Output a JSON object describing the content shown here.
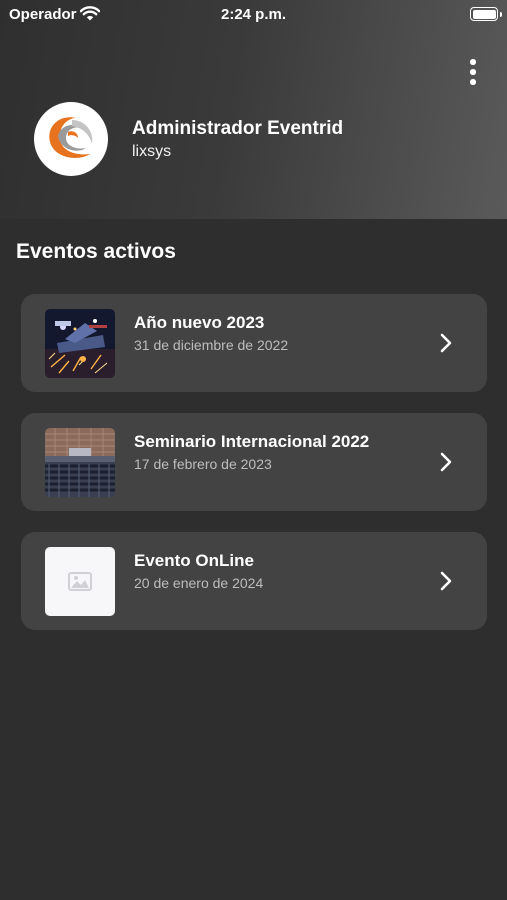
{
  "status_bar": {
    "carrier": "Operador",
    "time": "2:24 p.m.",
    "wifi_icon": "wifi-icon",
    "battery_icon": "battery-icon",
    "battery_level": 1.0
  },
  "header": {
    "menu_icon": "more-vertical-icon",
    "profile_name": "Administrador Eventrid",
    "profile_org": "lixsys",
    "avatar_icon": "eventrid-logo"
  },
  "section_title": "Eventos activos",
  "events": [
    {
      "title": "Año nuevo 2023",
      "date": "31 de diciembre de 2022",
      "thumbnail": "fireworks-photo"
    },
    {
      "title": "Seminario Internacional 2022",
      "date": "17 de febrero de 2023",
      "thumbnail": "auditorium-photo"
    },
    {
      "title": "Evento OnLine",
      "date": "20 de enero de 2024",
      "thumbnail": "image-placeholder-icon"
    }
  ],
  "colors": {
    "background": "#2e2e2e",
    "card": "#434343",
    "accent_orange": "#e8731e",
    "secondary_text": "#bdbdbd"
  }
}
